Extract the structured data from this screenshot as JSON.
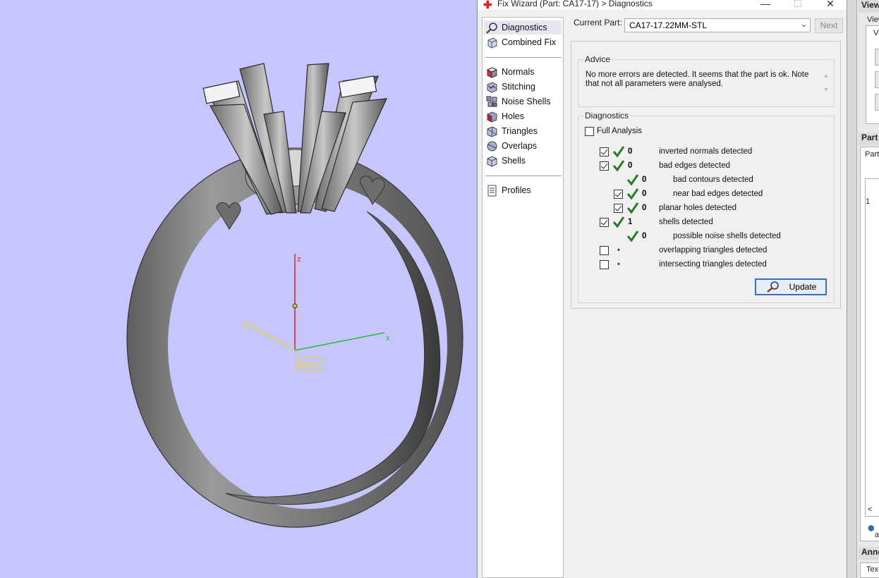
{
  "window": {
    "title": "Fix Wizard (Part: CA17-17) > Diagnostics",
    "minimize": "—",
    "maximize": "☐",
    "close": "✕"
  },
  "viewport": {
    "axis_z": "z",
    "axis_x": "x",
    "axis_y": "y",
    "wcs_label": "WCS",
    "colors": {
      "background": "#c6c6fc",
      "z_axis": "#e02020",
      "x_axis": "#22c030",
      "y_axis": "#e8d820"
    }
  },
  "nav": {
    "items": [
      {
        "label": "Diagnostics",
        "icon": "magnifier-icon"
      },
      {
        "label": "Combined Fix",
        "icon": "cube-icon"
      },
      {
        "label": "Normals",
        "icon": "normals-icon"
      },
      {
        "label": "Stitching",
        "icon": "stitching-icon"
      },
      {
        "label": "Noise Shells",
        "icon": "noise-shells-icon"
      },
      {
        "label": "Holes",
        "icon": "holes-icon"
      },
      {
        "label": "Triangles",
        "icon": "triangles-icon"
      },
      {
        "label": "Overlaps",
        "icon": "overlaps-icon"
      },
      {
        "label": "Shells",
        "icon": "shells-icon"
      },
      {
        "label": "Profiles",
        "icon": "document-icon"
      }
    ]
  },
  "main": {
    "current_part_label": "Current Part:",
    "current_part_value": "CA17-17.22MM-STL",
    "next_label": "Next",
    "advice_title": "Advice",
    "advice_text": "No more errors are detected. It seems that the part is ok. Note that not all parameters were analysed.",
    "diagnostics_title": "Diagnostics",
    "full_analysis_label": "Full Analysis",
    "update_label": "Update",
    "rows": [
      {
        "count": "0",
        "label": "inverted normals detected"
      },
      {
        "count": "0",
        "label": "bad edges detected"
      },
      {
        "count": "0",
        "label": "bad contours detected"
      },
      {
        "count": "0",
        "label": "near bad edges detected"
      },
      {
        "count": "0",
        "label": "planar holes detected"
      },
      {
        "count": "1",
        "label": "shells detected"
      },
      {
        "count": "0",
        "label": "possible noise shells detected"
      },
      {
        "count": "",
        "label": "overlapping triangles detected"
      },
      {
        "count": "",
        "label": "intersecting triangles detected"
      }
    ]
  },
  "right_panel": {
    "view_header": "View",
    "view_sub": "View",
    "view_sub2": "Vi",
    "part_header": "Part",
    "part_sub": "Part",
    "row_index": "1",
    "scroll_left": "<",
    "anno_header": "Anno",
    "text_label": "Tex",
    "a_label": "a"
  }
}
